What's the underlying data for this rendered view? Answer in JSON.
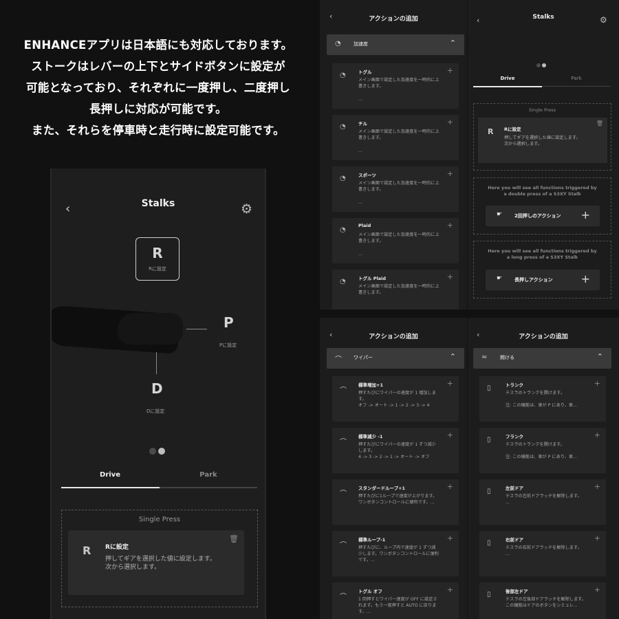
{
  "promo": {
    "lines": [
      "ENHANCEアプリは日本語にも対応しております。",
      "ストークはレバーの上下とサイドボタンに設定が",
      "可能となっており、それぞれに一度押し、二度押し",
      "長押しに対応が可能です。",
      "また、それらを停車時と走行時に設定可能です。"
    ]
  },
  "stalks_main": {
    "title": "Stalks",
    "gear_up": {
      "letter": "R",
      "caption": "Rに設定"
    },
    "gear_side": {
      "letter": "P",
      "caption": "Pに設定"
    },
    "gear_down": {
      "letter": "D",
      "caption": "Dに設定"
    },
    "tabs": [
      {
        "label": "Drive",
        "active": true
      },
      {
        "label": "Park",
        "active": false
      }
    ],
    "single_press": {
      "heading": "Single Press",
      "card": {
        "icon_letter": "R",
        "title": "Rに設定",
        "desc": "押してギアを選択した値に設定します。\n次から選択します。"
      }
    }
  },
  "accel_panel": {
    "title": "アクションの追加",
    "category": {
      "icon": "gauge-icon",
      "label": "加速度"
    },
    "items": [
      {
        "title": "トグル",
        "desc": "メイン画面で設定した加速度を一時的に上書きします。",
        "extra": "..."
      },
      {
        "title": "チル",
        "desc": "メイン画面で設定した加速度を一時的に上書きします。",
        "extra": "..."
      },
      {
        "title": "スポーツ",
        "desc": "メイン画面で設定した加速度を一時的に上書きします。",
        "extra": "..."
      },
      {
        "title": "Plaid",
        "desc": "メイン画面で設定した加速度を一時的に上書きします。",
        "extra": "..."
      },
      {
        "title": "トグル Plaid",
        "desc": "メイン画面で設定した加速度を一時的に上書きします。",
        "extra": ""
      }
    ]
  },
  "stalks_small": {
    "title": "Stalks",
    "tabs": [
      {
        "label": "Drive",
        "active": true
      },
      {
        "label": "Park",
        "active": false
      }
    ],
    "single_press": {
      "heading": "Single Press",
      "card": {
        "icon_letter": "R",
        "title": "Rに設定",
        "desc": "押してギアを選択した値に設定します。\n次から選択します。"
      }
    },
    "double_press": {
      "heading": "Here you will see all functions triggered by a double press of a S3XY Stalk",
      "button": "2回押しのアクション"
    },
    "long_press": {
      "heading": "Here you will see all functions triggered by a long press of a S3XY Stalk",
      "button": "長押しアクション"
    }
  },
  "wiper_panel": {
    "title": "アクションの追加",
    "category": {
      "icon": "wiper-icon",
      "label": "ワイパー"
    },
    "items": [
      {
        "title": "標準増加+1",
        "desc": "押すたびにワイパーの速度が 1 増加します。\nオフ -> オート -> 1 -> 2 -> 3 -> 4"
      },
      {
        "title": "標準減少 -1",
        "desc": "押すたびにワイパーの速度が 1 ずつ減少します。\n4 -> 3 -> 2 -> 1 -> オート -> オフ"
      },
      {
        "title": "スタンダードループ+1",
        "desc": "押すたびに1ループで速度が上がります。ワンボタンコントロールに便利です。..."
      },
      {
        "title": "標準ループ-1",
        "desc": "押すたびに、ループ内で速度が 1 ずつ減少します。ワンボタンコントロールに便利です。..."
      },
      {
        "title": "トグル オフ",
        "desc": "1 回押すとワイパー速度が OFF に設定されます。もう一度押すと AUTO に戻ります。..."
      }
    ]
  },
  "open_panel": {
    "title": "アクションの追加",
    "category": {
      "icon": "car-open-icon",
      "label": "開ける"
    },
    "items": [
      {
        "title": "トランク",
        "desc": "テスラのトランクを開けます。\n\n注: この機能は、車が P にあり、車..."
      },
      {
        "title": "フランク",
        "desc": "テスラのトランクを開けます。\n\n注: この機能は、車が P にあり、車..."
      },
      {
        "title": "左前ドア",
        "desc": "テスラの左前ドアラッチを解除します。\n..."
      },
      {
        "title": "右前ドア",
        "desc": "テスラの右前ドアラッチを解除します。\n..."
      },
      {
        "title": "後部左ドア",
        "desc": "テスラの左後部ドアラッチを解除します。\nこの機能はドアのボタンをシミュレ..."
      }
    ]
  }
}
